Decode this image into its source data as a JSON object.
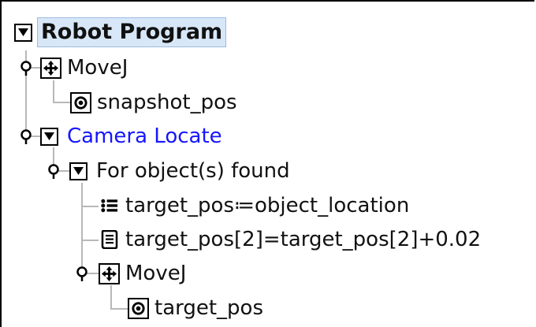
{
  "tree": {
    "root": {
      "label": "Robot Program"
    },
    "nodes": [
      {
        "label": "MoveJ",
        "icon": "move-cross-icon"
      },
      {
        "label": "snapshot_pos",
        "icon": "waypoint-icon"
      },
      {
        "label": "Camera Locate",
        "icon": "expand-triangle-icon",
        "color": "#1515ff"
      },
      {
        "label": "For object(s) found",
        "icon": "expand-triangle-icon"
      },
      {
        "label": "target_pos≔object_location",
        "icon": "assignment-list-icon"
      },
      {
        "label": "target_pos[2]=target_pos[2]+0.02",
        "icon": "script-icon"
      },
      {
        "label": "MoveJ",
        "icon": "move-cross-icon"
      },
      {
        "label": "target_pos",
        "icon": "waypoint-icon"
      }
    ]
  },
  "colors": {
    "selection_bg": "#d8e7f8",
    "link_text": "#1515ff",
    "tree_lines": "#b8b8b8"
  }
}
